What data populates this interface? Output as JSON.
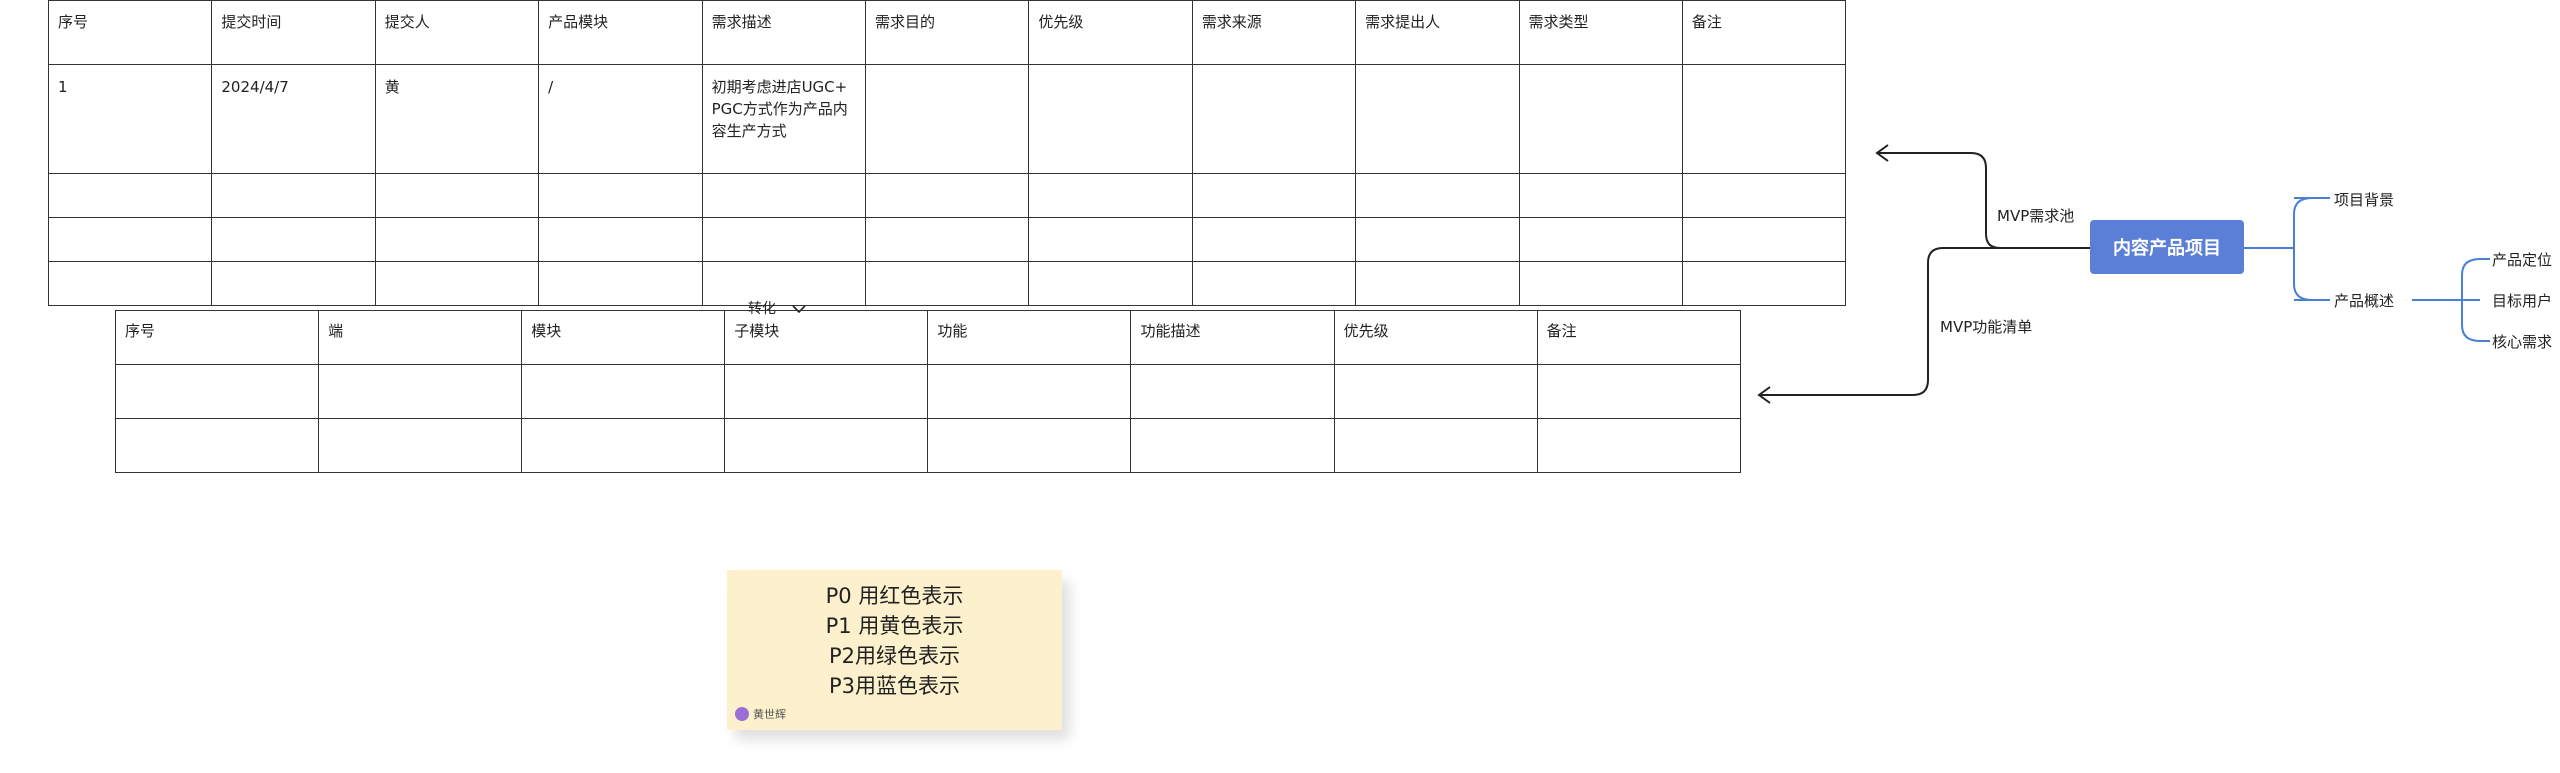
{
  "requirement_table": {
    "headers": [
      "序号",
      "提交时间",
      "提交人",
      "产品模块",
      "需求描述",
      "需求目的",
      "优先级",
      "需求来源",
      "需求提出人",
      "需求类型",
      "备注"
    ],
    "rows": [
      [
        "1",
        "2024/4/7",
        "黄",
        "/",
        "初期考虑进店UGC+PGC方式作为产品内容生产方式",
        "",
        "",
        "",
        "",
        "",
        ""
      ],
      [
        "",
        "",
        "",
        "",
        "",
        "",
        "",
        "",
        "",
        "",
        ""
      ],
      [
        "",
        "",
        "",
        "",
        "",
        "",
        "",
        "",
        "",
        "",
        ""
      ],
      [
        "",
        "",
        "",
        "",
        "",
        "",
        "",
        "",
        "",
        "",
        ""
      ]
    ]
  },
  "function_table": {
    "headers": [
      "序号",
      "端",
      "模块",
      "子模块",
      "功能",
      "功能描述",
      "优先级",
      "备注"
    ],
    "rows": [
      [
        "",
        "",
        "",
        "",
        "",
        "",
        "",
        ""
      ],
      [
        "",
        "",
        "",
        "",
        "",
        "",
        "",
        ""
      ]
    ]
  },
  "convert_label": "转化",
  "mindmap": {
    "root": "内容产品项目",
    "left_branches": [
      "MVP需求池",
      "MVP功能清单"
    ],
    "right_branches": [
      "项目背景",
      "产品概述"
    ],
    "overview_children": [
      "产品定位",
      "目标用户",
      "核心需求"
    ],
    "line_color": "#4a7fd6"
  },
  "sticky_note": {
    "lines": [
      "P0 用红色表示",
      "P1 用黄色表示",
      "P2用绿色表示",
      "P3用蓝色表示"
    ],
    "author": "黄世辉",
    "background": "#fdf0cc"
  }
}
